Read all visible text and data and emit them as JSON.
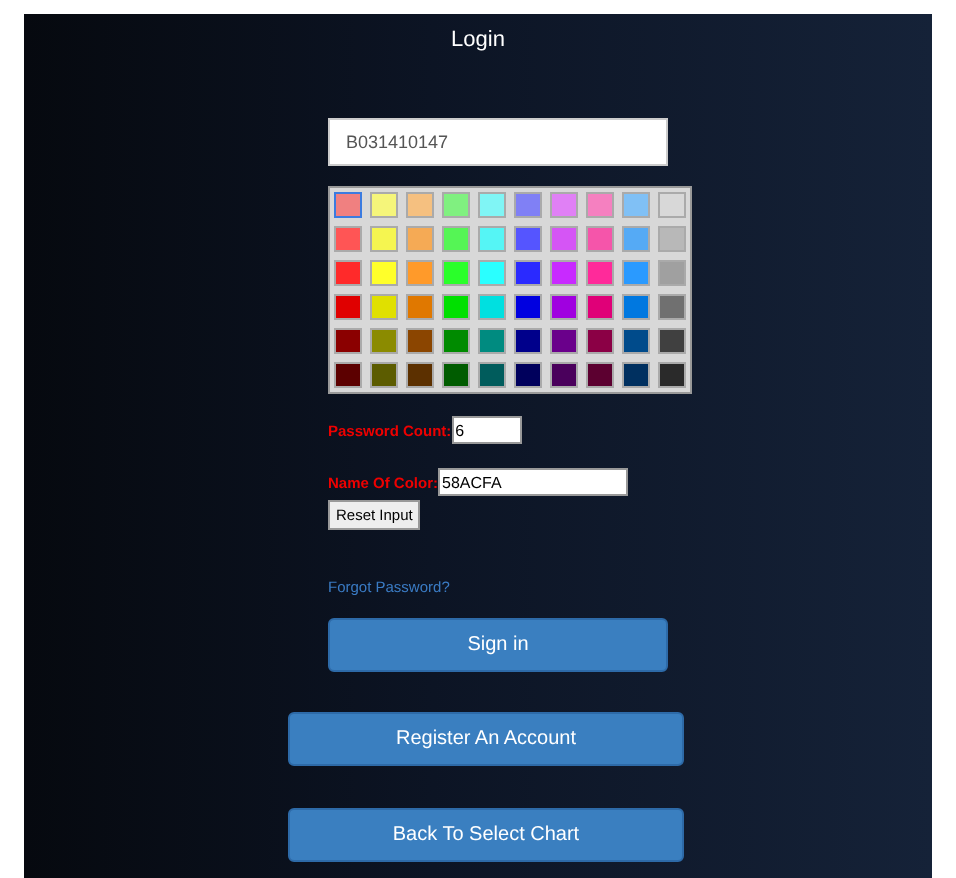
{
  "header": {
    "title": "Login"
  },
  "username": {
    "value": "B031410147"
  },
  "palette": [
    [
      {
        "color": "#f08080",
        "selected": true
      },
      {
        "color": "#f5f57a",
        "selected": false
      },
      {
        "color": "#f5c080",
        "selected": false
      },
      {
        "color": "#80f080",
        "selected": false
      },
      {
        "color": "#80f5f5",
        "selected": false
      },
      {
        "color": "#8080f5",
        "selected": false
      },
      {
        "color": "#e080f5",
        "selected": false
      },
      {
        "color": "#f580c0",
        "selected": false
      },
      {
        "color": "#80c0f5",
        "selected": false
      },
      {
        "color": "#d8d8d8",
        "selected": false
      }
    ],
    [
      {
        "color": "#ff5555",
        "selected": false
      },
      {
        "color": "#f5f550",
        "selected": false
      },
      {
        "color": "#f5aa55",
        "selected": false
      },
      {
        "color": "#55f555",
        "selected": false
      },
      {
        "color": "#55f5f5",
        "selected": false
      },
      {
        "color": "#5555ff",
        "selected": false
      },
      {
        "color": "#d555f5",
        "selected": false
      },
      {
        "color": "#f555aa",
        "selected": false
      },
      {
        "color": "#55aaf5",
        "selected": false
      },
      {
        "color": "#b8b8b8",
        "selected": false
      }
    ],
    [
      {
        "color": "#ff2a2a",
        "selected": false
      },
      {
        "color": "#ffff2a",
        "selected": false
      },
      {
        "color": "#ff9a2a",
        "selected": false
      },
      {
        "color": "#2aff2a",
        "selected": false
      },
      {
        "color": "#2affff",
        "selected": false
      },
      {
        "color": "#2a2aff",
        "selected": false
      },
      {
        "color": "#c82aff",
        "selected": false
      },
      {
        "color": "#ff2a9a",
        "selected": false
      },
      {
        "color": "#2a9aff",
        "selected": false
      },
      {
        "color": "#a0a0a0",
        "selected": false
      }
    ],
    [
      {
        "color": "#e00000",
        "selected": false
      },
      {
        "color": "#e0e000",
        "selected": false
      },
      {
        "color": "#e07800",
        "selected": false
      },
      {
        "color": "#00e000",
        "selected": false
      },
      {
        "color": "#00e0e0",
        "selected": false
      },
      {
        "color": "#0000e0",
        "selected": false
      },
      {
        "color": "#a000e0",
        "selected": false
      },
      {
        "color": "#e00078",
        "selected": false
      },
      {
        "color": "#0078e0",
        "selected": false
      },
      {
        "color": "#707070",
        "selected": false
      }
    ],
    [
      {
        "color": "#8b0000",
        "selected": false
      },
      {
        "color": "#8b8b00",
        "selected": false
      },
      {
        "color": "#8b4500",
        "selected": false
      },
      {
        "color": "#008b00",
        "selected": false
      },
      {
        "color": "#008b80",
        "selected": false
      },
      {
        "color": "#00008b",
        "selected": false
      },
      {
        "color": "#6a008b",
        "selected": false
      },
      {
        "color": "#8b0045",
        "selected": false
      },
      {
        "color": "#004b8b",
        "selected": false
      },
      {
        "color": "#404040",
        "selected": false
      }
    ],
    [
      {
        "color": "#5c0000",
        "selected": false
      },
      {
        "color": "#5c5c00",
        "selected": false
      },
      {
        "color": "#5c3000",
        "selected": false
      },
      {
        "color": "#005c00",
        "selected": false
      },
      {
        "color": "#005c5c",
        "selected": false
      },
      {
        "color": "#00005c",
        "selected": false
      },
      {
        "color": "#4a005c",
        "selected": false
      },
      {
        "color": "#5c0030",
        "selected": false
      },
      {
        "color": "#003060",
        "selected": false
      },
      {
        "color": "#2a2a2a",
        "selected": false
      }
    ]
  ],
  "password_count": {
    "label": "Password Count:",
    "value": "6"
  },
  "color_name": {
    "label": "Name Of Color:",
    "value": "58ACFA"
  },
  "reset_button": "Reset Input",
  "forgot_link": "Forgot Password?",
  "sign_in_button": "Sign in",
  "register_button": "Register An Account",
  "back_button": "Back To Select Chart"
}
